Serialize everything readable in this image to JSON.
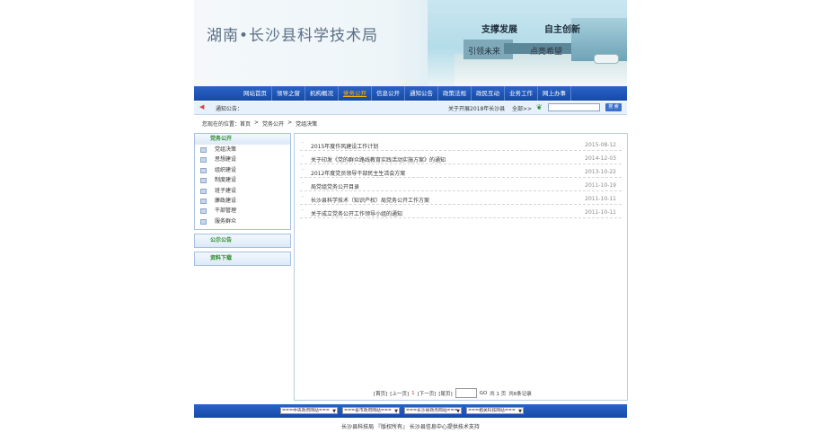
{
  "header": {
    "site_title": "湖南•长沙县科学技术局",
    "slogan_1": "支撑发展",
    "slogan_2": "自主创新",
    "slogan_3": "引领未来",
    "slogan_4": "点亮希望"
  },
  "nav": {
    "items": [
      {
        "label": "网站首页"
      },
      {
        "label": "领导之窗"
      },
      {
        "label": "机构概况"
      },
      {
        "label": "党务公开"
      },
      {
        "label": "信息公开"
      },
      {
        "label": "通知公告"
      },
      {
        "label": "政策法规"
      },
      {
        "label": "政民互动"
      },
      {
        "label": "业务工作"
      },
      {
        "label": "网上办事"
      }
    ],
    "active_index": 3
  },
  "notice": {
    "label": "通知公告：",
    "marquee_text": "关于开展2018年长沙县",
    "all_label": "全部>>",
    "search_placeholder": "",
    "search_button": "搜 索"
  },
  "breadcrumb": {
    "prefix": "您现在的位置：首页",
    "sep": ">",
    "level1": "党务公开",
    "level2": "党组决策"
  },
  "sidebar": {
    "panel1_title": "党务公开",
    "items": [
      {
        "label": "党组决策"
      },
      {
        "label": "思想建设"
      },
      {
        "label": "组织建设"
      },
      {
        "label": "制度建设"
      },
      {
        "label": "班子建设"
      },
      {
        "label": "廉政建设"
      },
      {
        "label": "干部管理"
      },
      {
        "label": "服务群众"
      }
    ],
    "panel2_title": "公示公告",
    "panel3_title": "资料下载"
  },
  "list": {
    "bullet": "·",
    "rows": [
      {
        "title": "2015年度作风建设工作计划",
        "date": "2015-08-12"
      },
      {
        "title": "关于印发《党的群众路线教育实践活动实施方案》的通知",
        "date": "2014-12-03"
      },
      {
        "title": "2012年度党员领导干部民主生活会方案",
        "date": "2013-10-22"
      },
      {
        "title": "局党组党务公开目录",
        "date": "2011-10-19"
      },
      {
        "title": "长沙县科学技术（知识产权）局党务公开工作方案",
        "date": "2011-10-11"
      },
      {
        "title": "关于成立党务公开工作领导小组的通知",
        "date": "2011-10-11"
      }
    ]
  },
  "pager": {
    "first": "[首页]",
    "prev": "[上一页]",
    "current": "1",
    "next": "[下一页]",
    "last": "[尾页]",
    "go": "GO",
    "total_pages": "共 1 页",
    "total_records": "共6条记录"
  },
  "footer": {
    "selects": [
      {
        "label": "===中央政府网站===",
        "arrow": "▼"
      },
      {
        "label": "===省市政府网站===",
        "arrow": "▼"
      },
      {
        "label": "===长沙县政务网站===",
        "arrow": "▼"
      },
      {
        "label": "===相关科技网站===",
        "arrow": "▼"
      }
    ],
    "copyright": "长沙县科技局 『版权所有』 长沙县信息中心提供技术支持"
  }
}
